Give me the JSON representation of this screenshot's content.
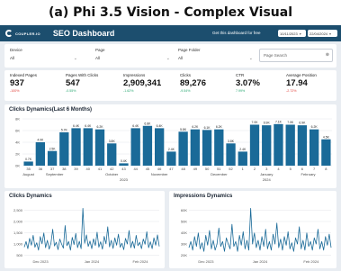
{
  "banner": {
    "title": "(a) Phi 3.5 Vision - Complex Visual"
  },
  "header": {
    "logo_text": "COUPLER.IO",
    "title": "SEO Dashboard",
    "link": "Get this dashboard for free",
    "date_start": "10/11/2023",
    "date_end": "22/04/2024"
  },
  "filters": [
    {
      "label": "Device",
      "value": "All"
    },
    {
      "label": "Page",
      "value": "All"
    },
    {
      "label": "Page Folder",
      "value": "All"
    }
  ],
  "search": {
    "placeholder": "Page Search"
  },
  "kpis": [
    {
      "label": "Indexed Pages",
      "value": "937",
      "delta": "-100%",
      "trend": "neg"
    },
    {
      "label": "Pages With Clicks",
      "value": "547",
      "delta": "-0.55%",
      "trend": "pos"
    },
    {
      "label": "Impressions",
      "value": "2,909,341",
      "delta": "-1.62%",
      "trend": "pos"
    },
    {
      "label": "Clicks",
      "value": "89,276",
      "delta": "-9.54%",
      "trend": "pos"
    },
    {
      "label": "CTR",
      "value": "3.07%",
      "delta": "7.99%",
      "trend": "pos"
    },
    {
      "label": "Average Position",
      "value": "17.94",
      "delta": "-2.72%",
      "trend": "neg"
    }
  ],
  "colors": {
    "header": "#1c4e6e",
    "bar": "#1a6a98",
    "line": "#1a6a98",
    "positive": "#2aa872",
    "negative": "#e0403a"
  },
  "chart_data": [
    {
      "type": "bar",
      "title": "Clicks Dynamics(Last 6 Months)",
      "categories": [
        "35",
        "36",
        "37",
        "38",
        "39",
        "40",
        "41",
        "42",
        "43",
        "44",
        "45",
        "46",
        "47",
        "48",
        "49",
        "50",
        "51",
        "52",
        "1",
        "2",
        "3",
        "4",
        "5",
        "6",
        "7",
        "8"
      ],
      "values": [
        700,
        4000,
        2500,
        5700,
        6400,
        6400,
        6200,
        3800,
        400,
        6400,
        6800,
        6400,
        2400,
        5800,
        6200,
        6100,
        6200,
        3800,
        2400,
        7000,
        6900,
        7100,
        7000,
        6900,
        6200,
        4500
      ],
      "data_labels": [
        "0.7K",
        "4.0K",
        "2.5K",
        "5.7K",
        "6.4K",
        "6.4K",
        "6.2K",
        "3.8K",
        "0.4K",
        "6.4K",
        "6.8K",
        "6.4K",
        "2.4K",
        "5.8K",
        "6.2K",
        "6.1K",
        "6.2K",
        "3.8K",
        "2.4K",
        "7.0K",
        "6.9K",
        "7.1K",
        "7.0K",
        "6.9K",
        "6.2K",
        "4.5K"
      ],
      "month_labels": [
        "August",
        "September",
        "October",
        "November",
        "December",
        "January",
        "February"
      ],
      "year_labels": [
        "2023",
        "2024"
      ],
      "yticks": [
        "0K",
        "2K",
        "4K",
        "6K",
        "8K"
      ],
      "ylim": [
        0,
        8000
      ],
      "grid": true
    },
    {
      "type": "line",
      "title": "Clicks Dynamics",
      "xticks": [
        "Dec 2023",
        "Jan 2024",
        "Feb 2024"
      ],
      "yticks": [
        "500",
        "1,000",
        "1,500",
        "2,000",
        "2,500"
      ],
      "ylim": [
        400,
        2600
      ],
      "values": [
        820,
        1050,
        760,
        1180,
        900,
        1300,
        820,
        1000,
        700,
        1250,
        960,
        1400,
        800,
        1100,
        740,
        980,
        1550,
        870,
        1020,
        720,
        1150,
        950,
        780,
        1700,
        880,
        1050,
        700,
        1220,
        930,
        1380,
        800,
        1060,
        760,
        2400,
        980,
        1320,
        850,
        1070,
        760,
        1160,
        890,
        1430,
        820,
        1040,
        740,
        1260,
        960,
        1650,
        830,
        1100,
        770,
        1200,
        900,
        1350,
        820,
        980,
        720,
        1180,
        950,
        1500,
        800,
        1060,
        780,
        1300,
        880,
        1020,
        760,
        1150,
        940,
        1450,
        800,
        1040,
        760,
        1200,
        900,
        1320,
        850
      ]
    },
    {
      "type": "line",
      "title": "Impressions Dynamics",
      "xticks": [
        "Dec 2023",
        "Jan 2024",
        "Feb 2024"
      ],
      "yticks": [
        "20K",
        "30K",
        "40K",
        "50K",
        "60K"
      ],
      "ylim": [
        18000,
        62000
      ],
      "values": [
        26000,
        31000,
        24000,
        35000,
        27000,
        38000,
        25000,
        30000,
        23000,
        36000,
        28000,
        40000,
        25000,
        32000,
        24000,
        29000,
        42000,
        27000,
        31000,
        23000,
        34000,
        29000,
        25000,
        45000,
        27000,
        31000,
        23000,
        36000,
        28000,
        39000,
        25000,
        32000,
        24000,
        58000,
        29000,
        38000,
        26000,
        32000,
        24000,
        35000,
        27000,
        41000,
        25000,
        31000,
        24000,
        37000,
        29000,
        46000,
        26000,
        33000,
        24000,
        35000,
        28000,
        39000,
        25000,
        30000,
        23000,
        34000,
        29000,
        43000,
        25000,
        32000,
        24000,
        38000,
        27000,
        31000,
        24000,
        34000,
        29000,
        41000,
        25000,
        31000,
        24000,
        35000,
        28000,
        37000,
        26000
      ]
    }
  ]
}
